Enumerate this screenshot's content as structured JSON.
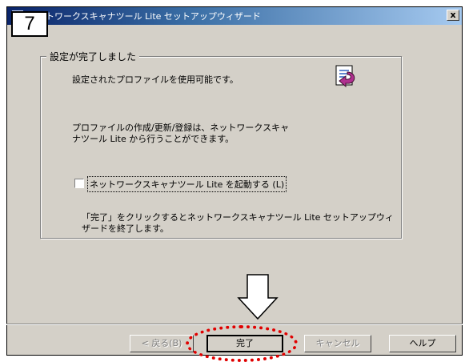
{
  "window": {
    "title": "ネットワークスキャナツール Lite セットアップウィザード",
    "close_glyph": "x"
  },
  "step_badge": "7",
  "group": {
    "legend": "設定が完了しました",
    "line1": "設定されたプロファイルを使用可能です。",
    "para2_line1": "プロファイルの作成/更新/登録は、ネットワークスキャ",
    "para2_line2": "ナツール Lite から行うことができます。",
    "checkbox_label": "ネットワークスキャナツール Lite を起動する (L)",
    "checkbox_checked": false,
    "para3_line1": "「完了」をクリックするとネットワークスキャナツール Lite セットアップウィ",
    "para3_line2": "ザードを終了します。"
  },
  "buttons": {
    "back": "< 戻る(B)",
    "finish": "完了",
    "cancel": "キャンセル",
    "help": "ヘルプ"
  },
  "colors": {
    "highlight": "#e00000",
    "title_start": "#0a246a",
    "title_end": "#a6caf0"
  }
}
